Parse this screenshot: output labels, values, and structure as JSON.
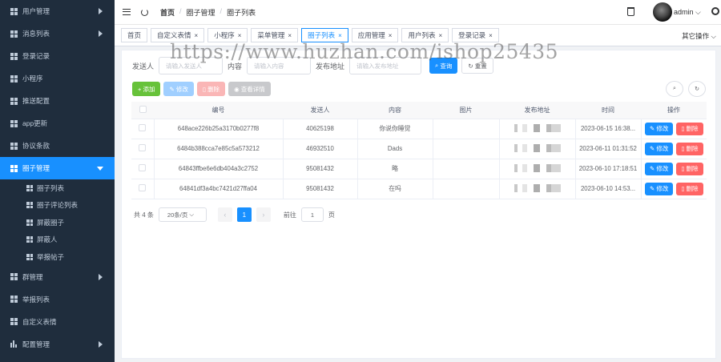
{
  "sidebar": {
    "items": [
      {
        "label": "用户管理",
        "arrow": true
      },
      {
        "label": "消息列表",
        "arrow": true
      },
      {
        "label": "登录记录",
        "arrow": false
      },
      {
        "label": "小程序",
        "arrow": false
      },
      {
        "label": "推送配置",
        "arrow": false
      },
      {
        "label": "app更新",
        "arrow": false
      },
      {
        "label": "协议条款",
        "arrow": false
      },
      {
        "label": "圈子管理",
        "arrow": true,
        "active": true
      }
    ],
    "sub_items": [
      {
        "label": "圈子列表"
      },
      {
        "label": "圈子评论列表"
      },
      {
        "label": "屏蔽圈子"
      },
      {
        "label": "屏蔽人"
      },
      {
        "label": "举报帖子"
      }
    ],
    "items_after": [
      {
        "label": "群管理",
        "arrow": true
      },
      {
        "label": "举报列表",
        "arrow": false
      },
      {
        "label": "自定义表情",
        "arrow": false
      },
      {
        "label": "配置管理",
        "arrow": true
      }
    ]
  },
  "topbar": {
    "breadcrumb": [
      "首页",
      "圈子管理",
      "圈子列表"
    ],
    "user": "admin"
  },
  "tags": {
    "items": [
      {
        "label": "首页",
        "closable": false
      },
      {
        "label": "自定义表情",
        "closable": true
      },
      {
        "label": "小程序",
        "closable": true
      },
      {
        "label": "菜单管理",
        "closable": true
      },
      {
        "label": "圈子列表",
        "closable": true,
        "active": true
      },
      {
        "label": "应用管理",
        "closable": true
      },
      {
        "label": "用户列表",
        "closable": true
      },
      {
        "label": "登录记录",
        "closable": true
      }
    ],
    "other_ops": "其它操作"
  },
  "filter": {
    "sender_label": "发送人",
    "sender_placeholder": "请输入发送人",
    "content_label": "内容",
    "content_placeholder": "请输入内容",
    "address_label": "发布地址",
    "address_placeholder": "请输入发布地址",
    "search_label": "查询",
    "reset_label": "重置"
  },
  "toolbar": {
    "add_label": "添加",
    "edit_label": "修改",
    "delete_label": "删除",
    "detail_label": "查看详情"
  },
  "table": {
    "columns": [
      "编号",
      "发送人",
      "内容",
      "图片",
      "发布地址",
      "时间",
      "操作"
    ],
    "rows": [
      {
        "id": "648ace226b25a3170b0277f8",
        "sender": "40625198",
        "content": "你说你睡觉",
        "image": "",
        "time": "2023-06-15 16:38..."
      },
      {
        "id": "6484b388cca7e85c5a573212",
        "sender": "46932510",
        "content": "Dads",
        "image": "",
        "time": "2023-06-11 01:31:52"
      },
      {
        "id": "64843ffbe6e6db404a3c2752",
        "sender": "95081432",
        "content": "略",
        "image": "",
        "time": "2023-06-10 17:18:51"
      },
      {
        "id": "64841df3a4bc7421d27ffa04",
        "sender": "95081432",
        "content": "在吗",
        "image": "",
        "time": "2023-06-10 14:53..."
      }
    ],
    "row_edit_label": "修改",
    "row_delete_label": "删除"
  },
  "pagination": {
    "total_text": "共 4 条",
    "page_size": "20条/页",
    "prev": "‹",
    "current_page": "1",
    "next": "›",
    "goto_label": "前往",
    "goto_value": "1",
    "page_suffix": "页"
  },
  "watermark": "https://www.huzhan.com/ishop25435",
  "colors": {
    "sidebar_bg": "#1f2d3d",
    "active": "#1890ff",
    "success": "#67c23a",
    "danger": "#ff4949"
  }
}
